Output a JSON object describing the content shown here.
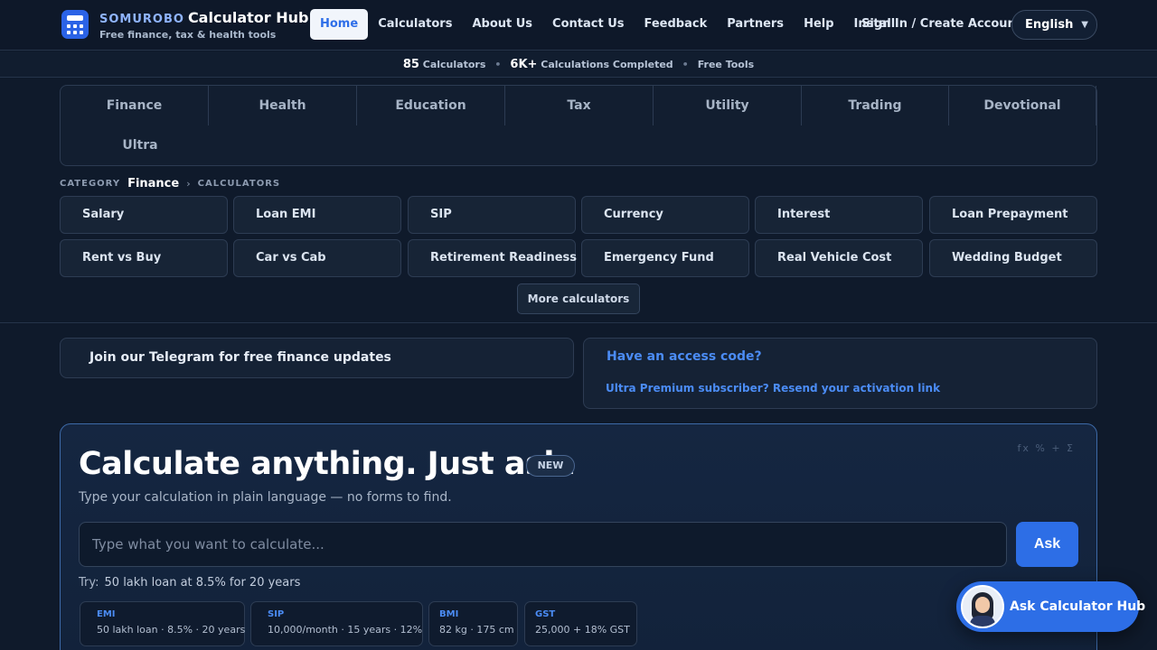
{
  "brand": {
    "prefix": "SOMUROBO",
    "name": "Calculator Hub",
    "tagline": "Free finance, tax & health tools"
  },
  "nav": {
    "items": [
      "Home",
      "Calculators",
      "About Us",
      "Contact Us",
      "Feedback",
      "Partners",
      "Help",
      "Install"
    ],
    "active": "Home",
    "signin": "Sign In / Create Account",
    "language": "English"
  },
  "stats": {
    "calculators_count": "85",
    "calculators_label": "Calculators",
    "completed_count": "6K+",
    "completed_label": "Calculations Completed",
    "free_label": "Free Tools"
  },
  "categories": [
    "Finance",
    "Health",
    "Education",
    "Tax",
    "Utility",
    "Trading",
    "Devotional",
    "Ultra"
  ],
  "breadcrumb": {
    "label": "CATEGORY",
    "current": "Finance",
    "section": "CALCULATORS"
  },
  "calculators": [
    "Salary",
    "Loan EMI",
    "SIP",
    "Currency",
    "Interest",
    "Loan Prepayment",
    "Rent vs Buy",
    "Car vs Cab",
    "Retirement Readiness",
    "Emergency Fund",
    "Real Vehicle Cost",
    "Wedding Budget"
  ],
  "more_label": "More calculators",
  "telegram": {
    "text": "Join our Telegram for free finance updates"
  },
  "access": {
    "title": "Have an access code?",
    "link": "Ultra Premium subscriber? Resend your activation link"
  },
  "ask": {
    "title": "Calculate anything. Just ask.",
    "badge": "NEW",
    "subtitle": "Type your calculation in plain language — no forms to find.",
    "decor": "fx %   + Σ",
    "placeholder": "Type what you want to calculate...",
    "button": "Ask",
    "try_label": "Try:",
    "try_example": "50 lakh loan at 8.5% for 20 years",
    "chips": [
      {
        "title": "EMI",
        "desc": "50 lakh loan · 8.5% · 20 years"
      },
      {
        "title": "SIP",
        "desc": "10,000/month · 15 years · 12%"
      },
      {
        "title": "BMI",
        "desc": "82 kg · 175 cm"
      },
      {
        "title": "GST",
        "desc": "25,000 + 18% GST"
      }
    ]
  },
  "assistant": {
    "label": "Ask Calculator Hub"
  }
}
